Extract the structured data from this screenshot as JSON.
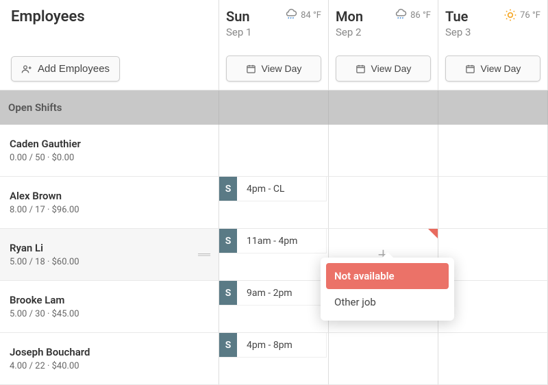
{
  "header": {
    "title": "Employees",
    "add_button": "Add Employees",
    "view_day": "View Day"
  },
  "days": [
    {
      "name": "Sun",
      "date": "Sep 1",
      "temp": "84 °F",
      "icon": "rain"
    },
    {
      "name": "Mon",
      "date": "Sep 2",
      "temp": "86 °F",
      "icon": "rain"
    },
    {
      "name": "Tue",
      "date": "Sep 3",
      "temp": "76 °F",
      "icon": "sun"
    }
  ],
  "open_shifts_label": "Open Shifts",
  "employees": [
    {
      "name": "Caden Gauthier",
      "stats": "0.00 / 50 · $0.00",
      "hover": false,
      "shifts": [
        null,
        null,
        null
      ]
    },
    {
      "name": "Alex Brown",
      "stats": "8.00 / 17 · $96.00",
      "hover": false,
      "shifts": [
        {
          "tag": "S",
          "time": "4pm - CL"
        },
        null,
        null
      ]
    },
    {
      "name": "Ryan Li",
      "stats": "5.00 / 18 · $60.00",
      "hover": true,
      "shifts": [
        {
          "tag": "S",
          "time": "11am - 4pm"
        },
        {
          "add": true,
          "flag": true,
          "popover": true
        },
        null
      ]
    },
    {
      "name": "Brooke Lam",
      "stats": "5.00 / 30 · $45.00",
      "hover": false,
      "shifts": [
        {
          "tag": "S",
          "time": "9am - 2pm"
        },
        null,
        null
      ]
    },
    {
      "name": "Joseph Bouchard",
      "stats": "4.00 / 22 · $40.00",
      "hover": false,
      "shifts": [
        {
          "tag": "S",
          "time": "4pm - 8pm"
        },
        null,
        null
      ]
    }
  ],
  "popover": {
    "not_available": "Not available",
    "other_job": "Other job"
  }
}
